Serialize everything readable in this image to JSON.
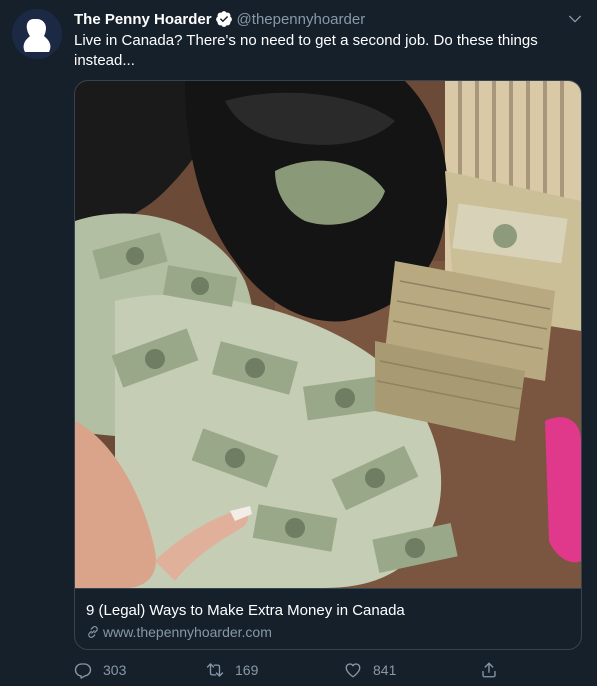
{
  "tweet": {
    "display_name": "The Penny Hoarder",
    "handle": "@thepennyhoarder",
    "text": "Live in Canada? There's no need to get a second job. Do these things instead...",
    "verified": true
  },
  "card": {
    "image_icon": "money-photo",
    "title": "9 (Legal) Ways to Make Extra Money in Canada",
    "link": "www.thepennyhoarder.com"
  },
  "actions": {
    "reply_count": "303",
    "retweet_count": "169",
    "like_count": "841"
  },
  "colors": {
    "background": "#15202b",
    "border": "#38444d",
    "secondary_text": "#8899a6",
    "verified_badge": "#ffffff"
  }
}
